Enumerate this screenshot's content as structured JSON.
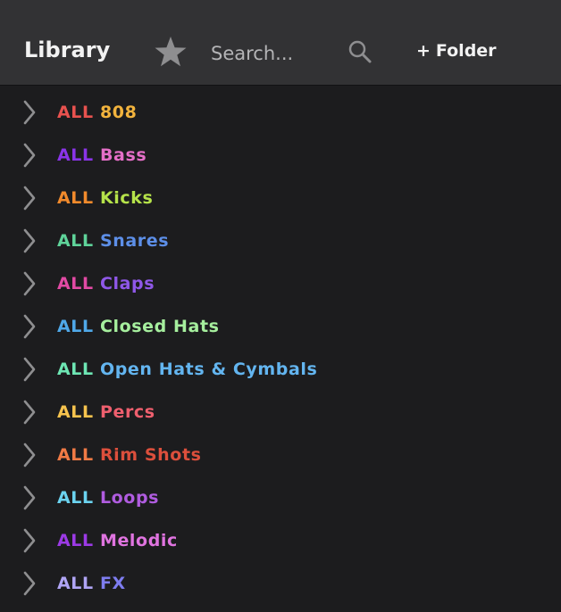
{
  "header": {
    "title": "Library",
    "favorites_icon": "star-icon",
    "search_placeholder": "Search...",
    "search_value": "",
    "search_icon": "magnifier-icon",
    "add_folder_plus": "+",
    "add_folder_label": "Folder"
  },
  "colors": {
    "background": "#1c1c1e",
    "header_background": "#323234",
    "icon_gray": "#8e8e90"
  },
  "folders": [
    {
      "prefix": "ALL",
      "name": "808",
      "prefix_color": "#e8524f",
      "name_color": "#f2b33d"
    },
    {
      "prefix": "ALL",
      "name": "Bass",
      "prefix_color": "#8a34e8",
      "name_color": "#e56fc8"
    },
    {
      "prefix": "ALL",
      "name": "Kicks",
      "prefix_color": "#f18a2c",
      "name_color": "#b6e34a"
    },
    {
      "prefix": "ALL",
      "name": "Snares",
      "prefix_color": "#5fd39a",
      "name_color": "#5d8fe8"
    },
    {
      "prefix": "ALL",
      "name": "Claps",
      "prefix_color": "#e24aa4",
      "name_color": "#8f58e8"
    },
    {
      "prefix": "ALL",
      "name": "Closed Hats",
      "prefix_color": "#4fa8e8",
      "name_color": "#a6ef9e"
    },
    {
      "prefix": "ALL",
      "name": "Open Hats & Cymbals",
      "prefix_color": "#6ee6b4",
      "name_color": "#63b5f0"
    },
    {
      "prefix": "ALL",
      "name": "Percs",
      "prefix_color": "#f6c34e",
      "name_color": "#ee5f6e"
    },
    {
      "prefix": "ALL",
      "name": "Rim Shots",
      "prefix_color": "#f07a45",
      "name_color": "#dc4f3c"
    },
    {
      "prefix": "ALL",
      "name": "Loops",
      "prefix_color": "#6bd3f0",
      "name_color": "#b05ce0"
    },
    {
      "prefix": "ALL",
      "name": "Melodic",
      "prefix_color": "#9c3ae6",
      "name_color": "#e074e0"
    },
    {
      "prefix": "ALL",
      "name": "FX",
      "prefix_color": "#b0a5f5",
      "name_color": "#7e7df0"
    }
  ]
}
